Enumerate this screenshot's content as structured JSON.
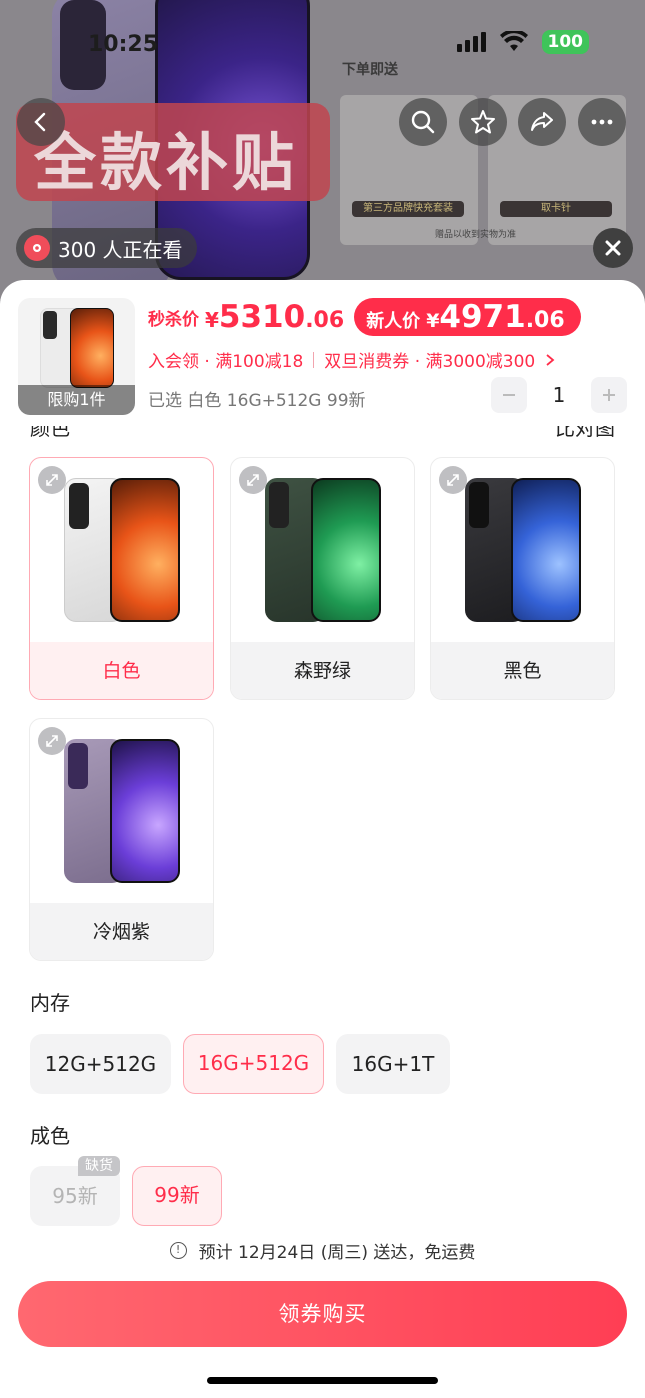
{
  "status_bar": {
    "time": "10:25",
    "battery": "100"
  },
  "backdrop": {
    "banner_text": "全款补贴",
    "side_title": "下单即送",
    "gift_tags": [
      "第三方品牌快充套装",
      "取卡针"
    ],
    "gift_note": "赠品以收到实物为准",
    "viewers": "300 人正在看"
  },
  "sheet": {
    "thumb_limit": "限购1件",
    "flash_label": "秒杀价",
    "flash_price": {
      "yen": "¥",
      "integer": "5310",
      "decimal": ".06"
    },
    "new_user": {
      "label": "新人价",
      "yen": "¥",
      "integer": "4971",
      "decimal": ".06"
    },
    "promo_1": "入会领 · 满100减18",
    "promo_2": "双旦消费券 · 满3000减300",
    "selected": "已选 白色 16G+512G 99新",
    "quantity": "1",
    "color_section_cutoff": "颜色",
    "color_right_cutoff": "比对图",
    "colors": [
      {
        "name": "白色",
        "selected": true
      },
      {
        "name": "森野绿",
        "selected": false
      },
      {
        "name": "黑色",
        "selected": false
      },
      {
        "name": "冷烟紫",
        "selected": false
      }
    ],
    "memory_title": "内存",
    "memory": [
      {
        "label": "12G+512G",
        "selected": false
      },
      {
        "label": "16G+512G",
        "selected": true
      },
      {
        "label": "16G+1T",
        "selected": false
      }
    ],
    "condition_title": "成色",
    "condition": [
      {
        "label": "95新",
        "badge": "缺货",
        "disabled": true
      },
      {
        "label": "99新",
        "selected": true
      }
    ],
    "delivery_note": "预计 12月24日 (周三) 送达，免运费",
    "buy_button": "领券购买"
  },
  "colors": {
    "accent": "#ff2d4a",
    "accent_light": "#fff0f1",
    "chip_bg": "#f3f3f4"
  }
}
